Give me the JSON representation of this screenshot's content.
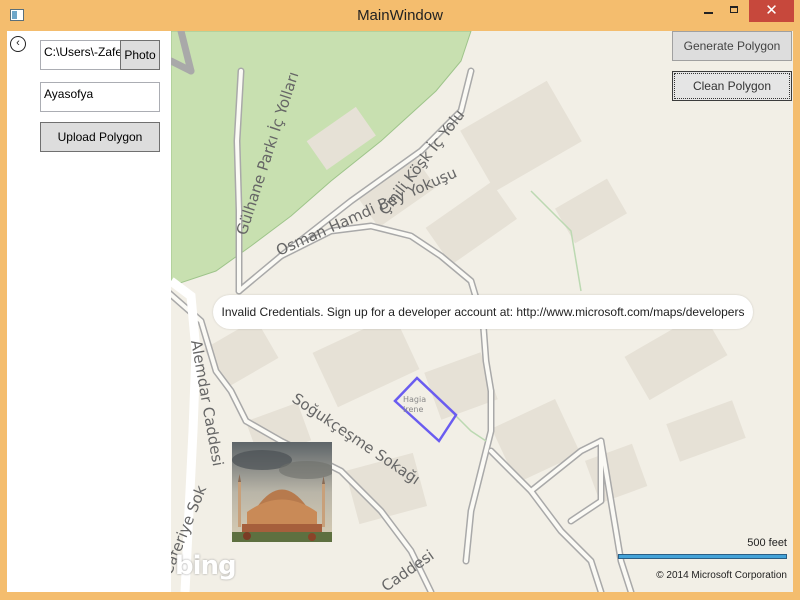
{
  "window": {
    "title": "MainWindow",
    "minimize_icon": "minimize-icon",
    "maximize_icon": "maximize-icon",
    "close_label": "✕"
  },
  "left_panel": {
    "back_icon": "back-arrow-icon",
    "back_glyph": "‹",
    "path_value": "C:\\Users\\-Zafe",
    "photo_button": "Photo",
    "name_value": "Ayasofya",
    "upload_button": "Upload Polygon"
  },
  "map": {
    "generate_button": "Generate Polygon",
    "clean_button": "Clean Polygon",
    "credentials_message": "Invalid Credentials. Sign up for a developer account at: http://www.microsoft.com/maps/developers",
    "streets": [
      "Gülhane Parkı İç Yolları",
      "Çinili Köşk İç Yolu",
      "Osman Hamdi Bey Yokuşu",
      "Alemdar Caddesi",
      "Soğukçeşme Sokağı",
      "Caferiye Sok",
      "Caddesi"
    ],
    "poi_label": "Hagia Irene",
    "scale_label": "500 feet",
    "copyright": "© 2014 Microsoft Corporation",
    "logo": "bing",
    "polygon_color": "#6a5cf0"
  }
}
